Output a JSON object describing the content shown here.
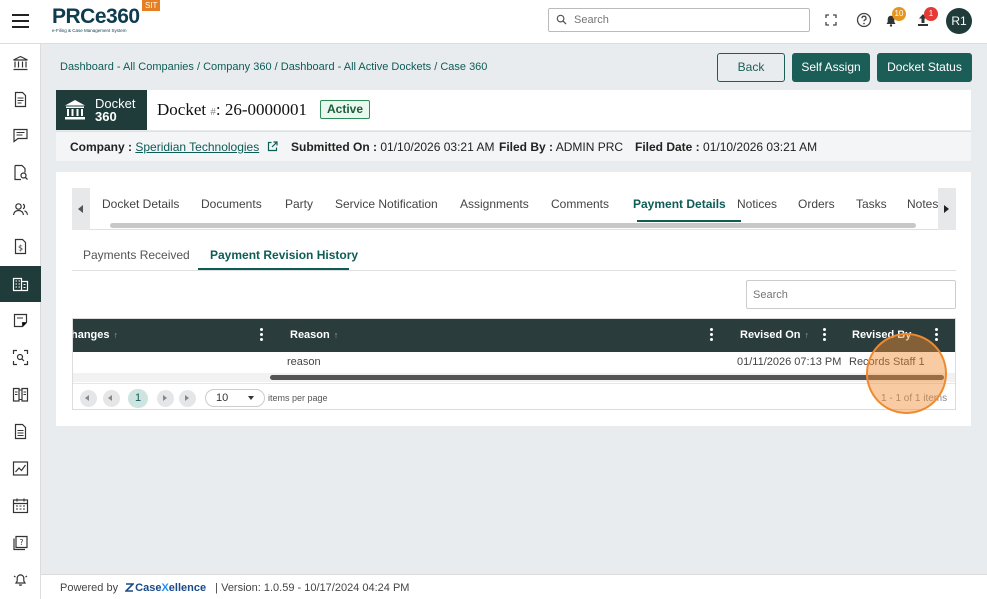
{
  "app": {
    "logo_text": "PRCe360",
    "logo_subtitle": "e-Filing & Case Management System",
    "env_badge": "SIT"
  },
  "topbar": {
    "search_placeholder": "Search",
    "notifications_count": "10",
    "uploads_count": "1",
    "avatar_initials": "R1"
  },
  "colors": {
    "primary": "#1b5e58",
    "dark": "#1f3b3a",
    "header_bg": "#2b3c3c",
    "accent_orange": "#e67e22"
  },
  "sidenav": {
    "items": [
      "bank-icon",
      "document-icon",
      "chat-icon",
      "search-document-icon",
      "users-icon",
      "dollar-document-icon",
      "building-icon",
      "note-icon",
      "scan-icon",
      "book-icon",
      "file-icon",
      "chart-icon",
      "calendar-icon",
      "help-book-icon",
      "bell-icon"
    ],
    "active_index": 6
  },
  "breadcrumb": {
    "items": [
      "Dashboard - All Companies",
      "Company 360",
      "Dashboard - All Active Dockets",
      "Case 360"
    ],
    "separator": " / "
  },
  "actions": {
    "back": "Back",
    "self_assign": "Self Assign",
    "docket_status": "Docket Status"
  },
  "docket": {
    "badge_line1": "Docket",
    "badge_line2": "360",
    "title_prefix": "Docket",
    "title_hash": "#",
    "title_number": ": 26-0000001",
    "status": "Active"
  },
  "info": {
    "company_label": "Company :",
    "company_value": "Speridian Technologies",
    "submitted_label": "Submitted On :",
    "submitted_value": "01/10/2026 03:21 AM",
    "filed_by_label": "Filed By :",
    "filed_by_value": "ADMIN PRC",
    "filed_date_label": "Filed Date :",
    "filed_date_value": "01/10/2026 03:21 AM"
  },
  "tabs": {
    "items": [
      "Docket Details",
      "Documents",
      "Party",
      "Service Notification",
      "Assignments",
      "Comments",
      "Payment Details",
      "Notices",
      "Orders",
      "Tasks",
      "Notes"
    ],
    "active": "Payment Details"
  },
  "subtabs": {
    "items": [
      "Payments Received",
      "Payment Revision History"
    ],
    "active": "Payment Revision History"
  },
  "grid": {
    "search_placeholder": "Search",
    "columns": [
      "hanges",
      "Reason",
      "Revised On",
      "Revised By"
    ],
    "rows": [
      {
        "changes": "",
        "reason": "reason",
        "revised_on": "01/11/2026 07:13 PM",
        "revised_by": "Records Staff 1"
      }
    ],
    "pager": {
      "current_page": "1",
      "per_page": "10",
      "per_page_label": "items per page",
      "range": "1 - 1 of 1 items"
    }
  },
  "footer": {
    "powered_by": "Powered by",
    "brand_case": "Case",
    "brand_x": "X",
    "brand_rest": "ellence",
    "version": "|  Version: 1.0.59 - 10/17/2024 04:24 PM"
  }
}
